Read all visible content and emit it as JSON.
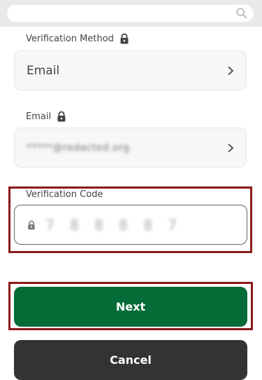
{
  "header": {
    "search_icon": "search-icon"
  },
  "verification_method": {
    "label": "Verification Method",
    "value": "Email"
  },
  "email": {
    "label": "Email",
    "value": "*****@redacted.org"
  },
  "verification_code": {
    "label": "Verification Code",
    "value": "7 8 8 8 8 7"
  },
  "actions": {
    "next_label": "Next",
    "cancel_label": "Cancel"
  },
  "colors": {
    "primary": "#056b37",
    "secondary": "#333333",
    "highlight": "#8b1a1a"
  }
}
